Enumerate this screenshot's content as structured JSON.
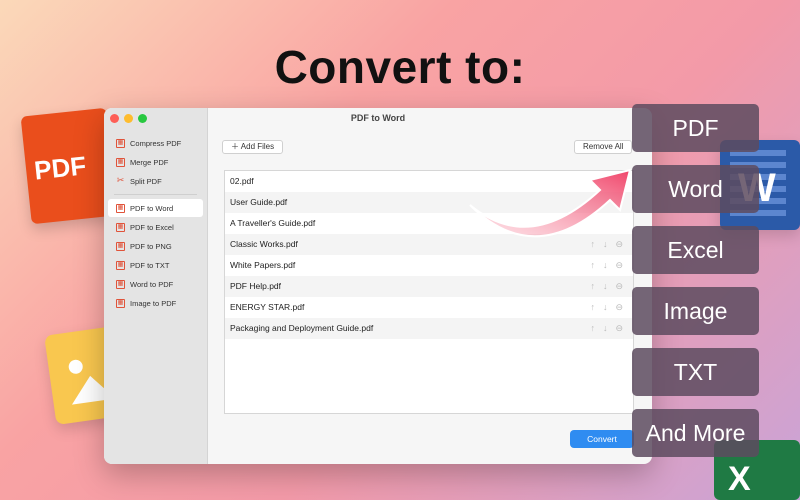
{
  "headline": "Convert to:",
  "deco": {
    "pdf_badge": "PDF",
    "word_badge": "W",
    "excel_badge": "X"
  },
  "window": {
    "title": "PDF to Word",
    "sidebar": [
      {
        "label": "Compress PDF",
        "icon": "compress-icon"
      },
      {
        "label": "Merge PDF",
        "icon": "merge-icon"
      },
      {
        "label": "Split PDF",
        "icon": "split-icon"
      },
      {
        "label": "PDF to Word",
        "icon": "pdf-to-word-icon",
        "active": true
      },
      {
        "label": "PDF to Excel",
        "icon": "pdf-to-excel-icon"
      },
      {
        "label": "PDF to PNG",
        "icon": "pdf-to-png-icon"
      },
      {
        "label": "PDF to TXT",
        "icon": "pdf-to-txt-icon"
      },
      {
        "label": "Word to PDF",
        "icon": "word-to-pdf-icon"
      },
      {
        "label": "Image to PDF",
        "icon": "image-to-pdf-icon"
      }
    ],
    "add_files": "Add Files",
    "remove_all": "Remove All",
    "files": [
      "02.pdf",
      "User Guide.pdf",
      "A Traveller's Guide.pdf",
      "Classic Works.pdf",
      "White Papers.pdf",
      "PDF Help.pdf",
      "ENERGY STAR.pdf",
      "Packaging and Deployment Guide.pdf"
    ],
    "convert": "Convert"
  },
  "formats": [
    "PDF",
    "Word",
    "Excel",
    "Image",
    "TXT",
    "And More"
  ]
}
